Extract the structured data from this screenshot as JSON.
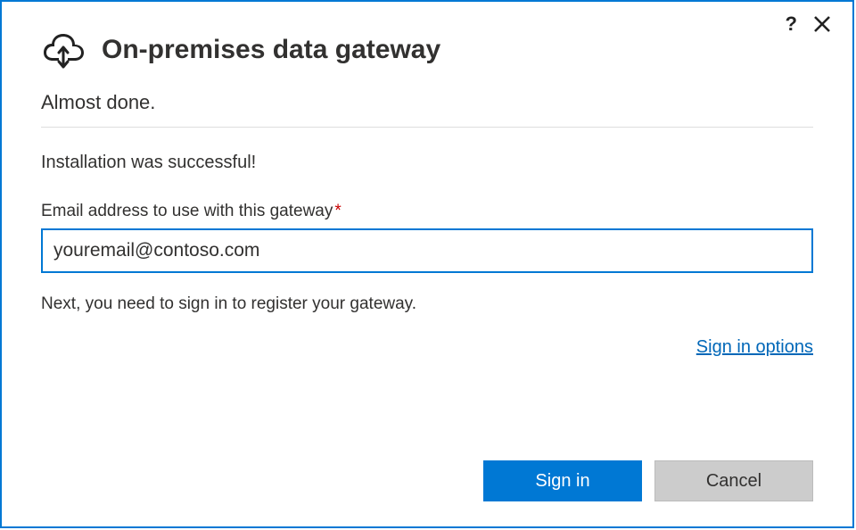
{
  "header": {
    "title": "On-premises data gateway",
    "help_tooltip": "?",
    "close_tooltip": "✕"
  },
  "body": {
    "subtitle": "Almost done.",
    "status": "Installation was successful!",
    "email_label": "Email address to use with this gateway",
    "required_mark": "*",
    "email_value": "youremail@contoso.com",
    "next_info": "Next, you need to sign in to register your gateway.",
    "signin_options": "Sign in options"
  },
  "buttons": {
    "signin": "Sign in",
    "cancel": "Cancel"
  }
}
